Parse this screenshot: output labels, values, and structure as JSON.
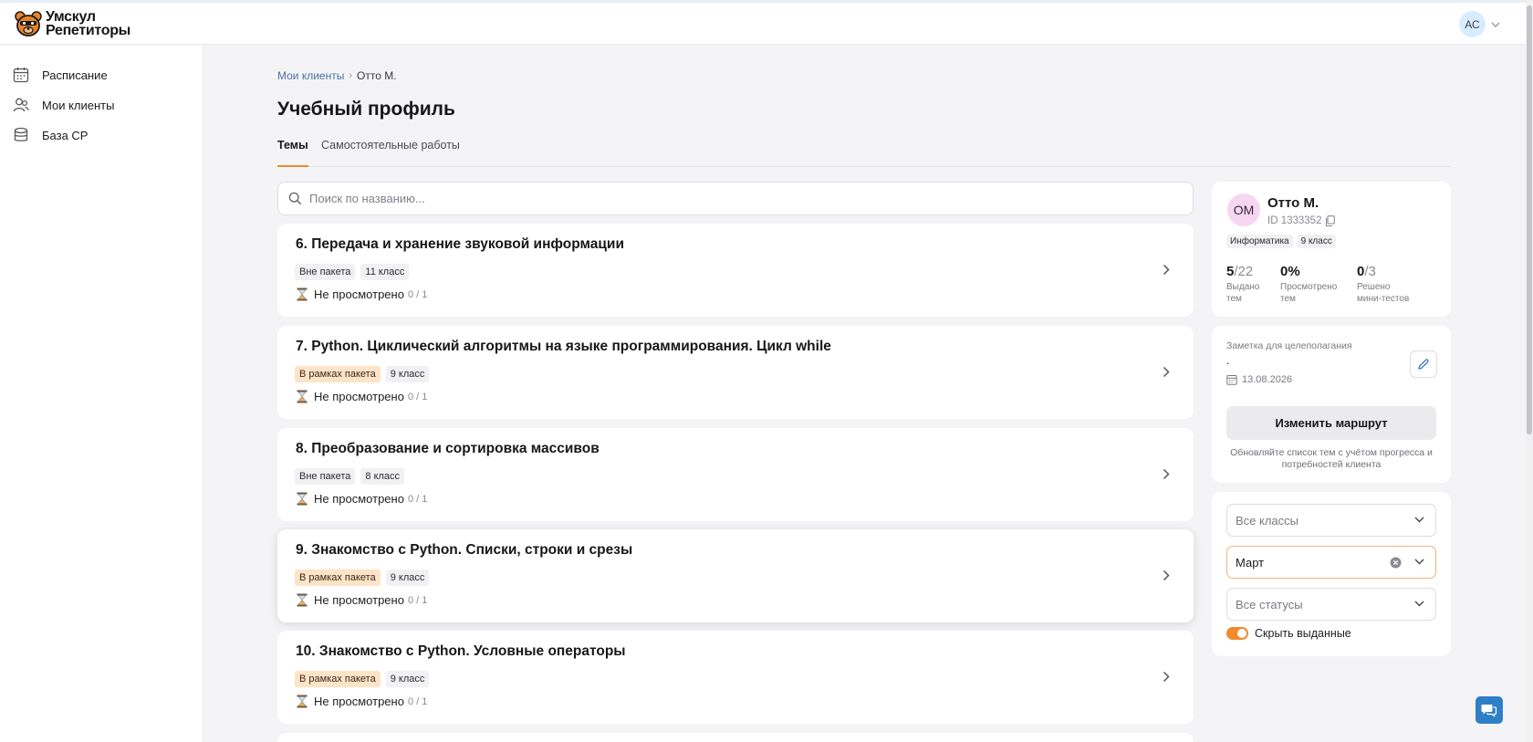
{
  "app": {
    "logo_line1": "Умскул",
    "logo_line2": "Репетиторы",
    "user_initials": "АС"
  },
  "sidebar": {
    "items": [
      {
        "label": "Расписание",
        "icon": "calendar-icon"
      },
      {
        "label": "Мои клиенты",
        "icon": "users-icon"
      },
      {
        "label": "База СР",
        "icon": "database-icon"
      }
    ]
  },
  "breadcrumb": {
    "parent": "Мои клиенты",
    "separator": "›",
    "current": "Отто М."
  },
  "page": {
    "title": "Учебный профиль",
    "tabs": [
      {
        "label": "Темы",
        "active": true
      },
      {
        "label": "Самостоятельные работы",
        "active": false
      }
    ]
  },
  "search": {
    "placeholder": "Поиск по названию...",
    "value": ""
  },
  "topics": [
    {
      "title": "6. Передача и хранение звуковой информации",
      "package": "Вне пакета",
      "in_package": false,
      "grade": "11 класс",
      "status": "Не просмотрено",
      "progress": "0 / 1"
    },
    {
      "title": "7. Python. Циклический алгоритмы на языке программирования. Цикл while",
      "package": "В рамках пакета",
      "in_package": true,
      "grade": "9 класс",
      "status": "Не просмотрено",
      "progress": "0 / 1"
    },
    {
      "title": "8. Преобразование и сортировка массивов",
      "package": "Вне пакета",
      "in_package": false,
      "grade": "8 класс",
      "status": "Не просмотрено",
      "progress": "0 / 1"
    },
    {
      "title": "9. Знакомство с Python. Списки, строки и срезы",
      "package": "В рамках пакета",
      "in_package": true,
      "grade": "9 класс",
      "status": "Не просмотрено",
      "progress": "0 / 1"
    },
    {
      "title": "10. Знакомство с Python. Условные операторы",
      "package": "В рамках пакета",
      "in_package": true,
      "grade": "9 класс",
      "status": "Не просмотрено",
      "progress": "0 / 1"
    }
  ],
  "client": {
    "initials": "ОМ",
    "name": "Отто М.",
    "id": "ID 1333352",
    "subject": "Информатика",
    "grade": "9 класс",
    "stats": [
      {
        "value": "5",
        "total": "/22",
        "label_line1": "Выдано",
        "label_line2": "тем"
      },
      {
        "value": "0%",
        "total": "",
        "label_line1": "Просмотрено",
        "label_line2": "тем"
      },
      {
        "value": "0",
        "total": "/3",
        "label_line1": "Решено",
        "label_line2": "мини-тестов"
      }
    ]
  },
  "note": {
    "label": "Заметка для целеполагания",
    "text": ".",
    "date": "13.08.2026",
    "route_button": "Изменить маршрут",
    "hint": "Обновляйте список тем с учётом прогресса и потребностей клиента"
  },
  "filters": {
    "grade": {
      "value": "",
      "placeholder": "Все классы"
    },
    "month": {
      "value": "Март",
      "placeholder": ""
    },
    "status": {
      "value": "",
      "placeholder": "Все статусы"
    },
    "hide_issued": {
      "label": "Скрыть выданные",
      "on": true
    }
  },
  "colors": {
    "accent": "#f08a2c",
    "package_tag": "#fde3c7",
    "link": "#4a6fa5",
    "chat": "#2f7fc7"
  }
}
